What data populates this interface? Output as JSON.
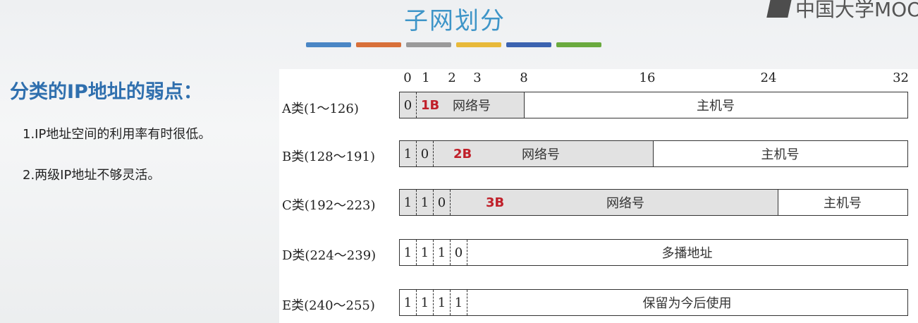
{
  "logo": {
    "text": "中国大学MOOC",
    "mark_color": "#4d4d4d"
  },
  "title": "子网划分",
  "color_bar": [
    "#4a86c5",
    "#d8703a",
    "#9a9a9a",
    "#e8b93a",
    "#3b63b0",
    "#6aaa3e"
  ],
  "heading": "分类的IP地址的弱点：",
  "points": [
    "1.IP地址空间的利用率有时很低。",
    "2.两级IP地址不够灵活。"
  ],
  "bit_positions": [
    "0",
    "1",
    "2",
    "3",
    "8",
    "16",
    "24",
    "32"
  ],
  "classes": [
    {
      "label": "A类(1～126)",
      "bits": [
        "0"
      ],
      "bytes": "1B",
      "network": "网络号",
      "host": "主机号"
    },
    {
      "label": "B类(128～191)",
      "bits": [
        "1",
        "0"
      ],
      "bytes": "2B",
      "network": "网络号",
      "host": "主机号"
    },
    {
      "label": "C类(192～223)",
      "bits": [
        "1",
        "1",
        "0"
      ],
      "bytes": "3B",
      "network": "网络号",
      "host": "主机号"
    },
    {
      "label": "D类(224～239)",
      "bits": [
        "1",
        "1",
        "1",
        "0"
      ],
      "rest": "多播地址"
    },
    {
      "label": "E类(240～255)",
      "bits": [
        "1",
        "1",
        "1",
        "1"
      ],
      "rest": "保留为今后使用"
    }
  ]
}
